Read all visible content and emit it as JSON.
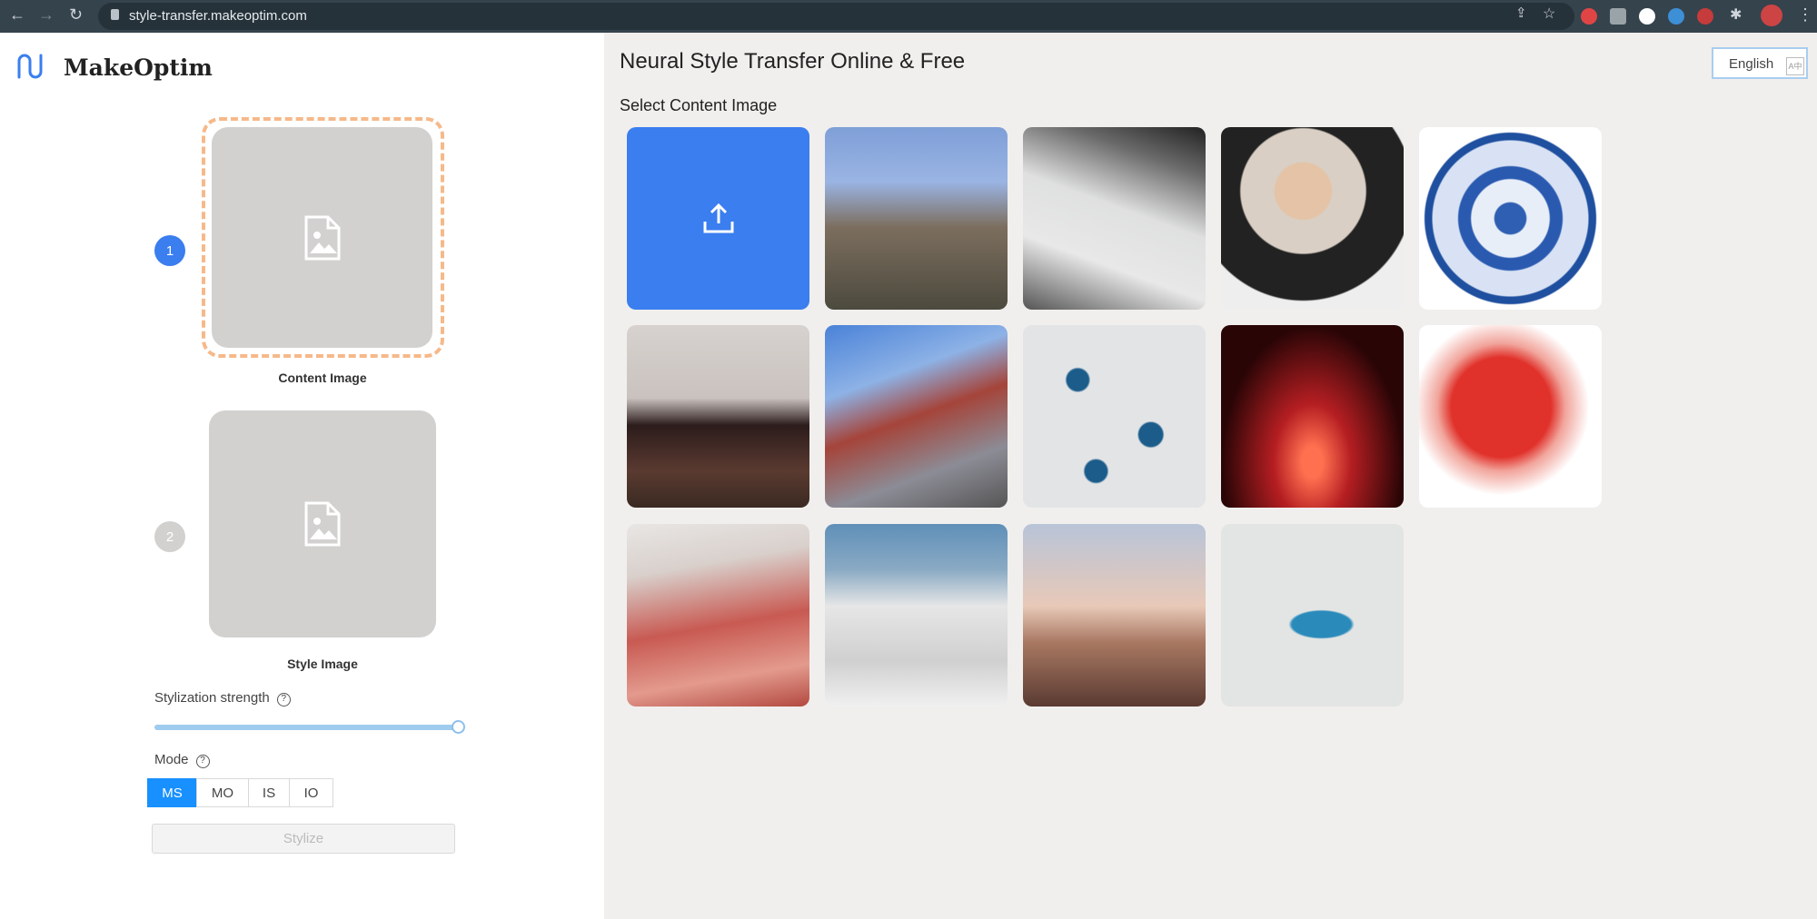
{
  "browser": {
    "url": "style-transfer.makeoptim.com"
  },
  "brand": {
    "name": "MakeOptim"
  },
  "steps": [
    {
      "number": "1",
      "label": "Content Image"
    },
    {
      "number": "2",
      "label": "Style Image"
    }
  ],
  "controls": {
    "strength_label": "Stylization strength",
    "strength_value": 1.0,
    "mode_label": "Mode",
    "modes": [
      "MS",
      "MO",
      "IS",
      "IO"
    ],
    "active_mode": "MS",
    "stylize_label": "Stylize"
  },
  "header": {
    "title": "Neural Style Transfer Online & Free",
    "language": "English"
  },
  "gallery": {
    "heading": "Select Content Image",
    "upload_icon": "upload-icon",
    "images": [
      "great-wall",
      "chinese-rooftops",
      "portrait-woman",
      "blue-porcelain-plate",
      "black-tea-cup",
      "modern-building",
      "evil-eye-beads",
      "red-sunset-tree",
      "red-papercut-woman",
      "red-temple-domes",
      "white-temple",
      "hot-air-balloons",
      "marble-texture-flower"
    ]
  },
  "colors": {
    "accent": "#1890ff",
    "upload": "#3a7eef",
    "dash": "#f6b98a"
  }
}
